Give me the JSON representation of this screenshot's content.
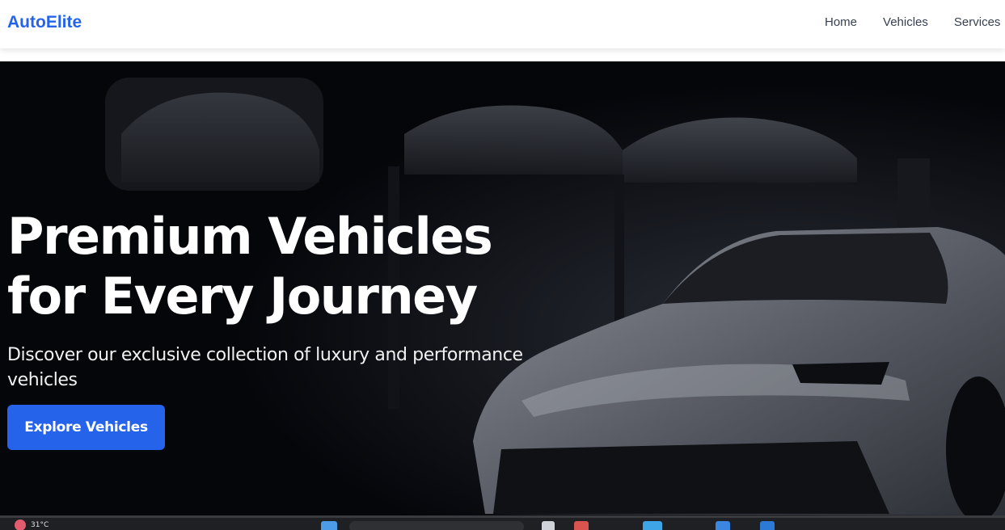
{
  "header": {
    "brand": "AutoElite",
    "nav": [
      {
        "label": "Home"
      },
      {
        "label": "Vehicles"
      },
      {
        "label": "Services"
      }
    ]
  },
  "hero": {
    "title_line1": "Premium Vehicles",
    "title_line2": "for Every Journey",
    "subtitle": "Discover our exclusive collection of luxury and performance vehicles",
    "cta_label": "Explore Vehicles"
  },
  "taskbar": {
    "weather_text": "31°C"
  },
  "colors": {
    "brand": "#2563eb",
    "hero_bg": "#05060a",
    "nav_text": "#374151",
    "cta_bg": "#2563eb"
  }
}
